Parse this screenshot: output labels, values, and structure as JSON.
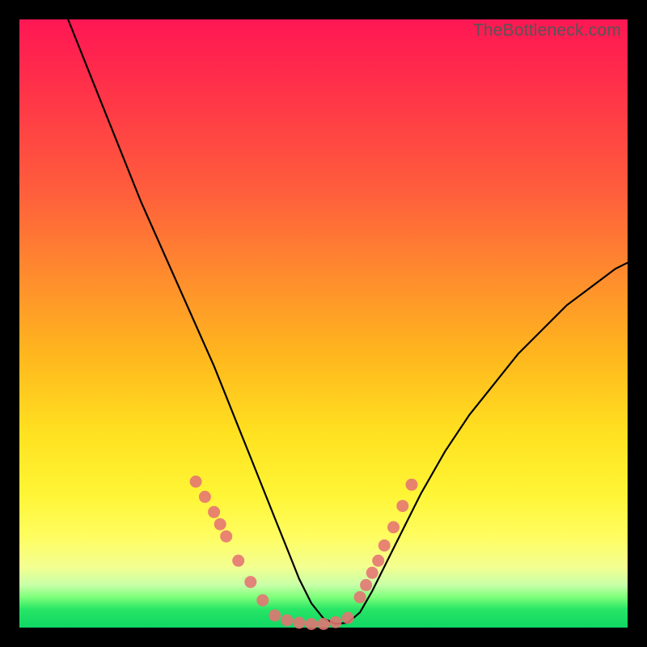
{
  "watermark": "TheBottleneck.com",
  "chart_data": {
    "type": "line",
    "title": "",
    "xlabel": "",
    "ylabel": "",
    "xlim": [
      0,
      100
    ],
    "ylim": [
      0,
      100
    ],
    "grid": false,
    "legend": false,
    "background_gradient": {
      "top": "#ff1754",
      "mid_upper": "#ff8b2e",
      "mid_lower": "#fff535",
      "bottom": "#0fd664"
    },
    "series": [
      {
        "name": "bottleneck-curve",
        "x": [
          8,
          12,
          16,
          20,
          24,
          28,
          32,
          34,
          36,
          38,
          40,
          42,
          44,
          46,
          48,
          50,
          52,
          54,
          56,
          58,
          62,
          66,
          70,
          74,
          78,
          82,
          86,
          90,
          94,
          98,
          100
        ],
        "values": [
          100,
          90,
          80,
          70,
          61,
          52,
          43,
          38,
          33,
          28,
          23,
          18,
          13,
          8,
          4,
          1.5,
          0.6,
          0.8,
          2.5,
          6,
          14,
          22,
          29,
          35,
          40,
          45,
          49,
          53,
          56,
          59,
          60
        ]
      },
      {
        "name": "highlight-dots-left",
        "x": [
          29,
          30.5,
          32,
          33,
          34,
          36,
          38,
          40
        ],
        "values": [
          24,
          21.5,
          19,
          17,
          15,
          11,
          7.5,
          4.5
        ]
      },
      {
        "name": "highlight-dots-bottom",
        "x": [
          42,
          44,
          46,
          48,
          50,
          52,
          54
        ],
        "values": [
          2.0,
          1.2,
          0.8,
          0.6,
          0.6,
          0.9,
          1.6
        ]
      },
      {
        "name": "highlight-dots-right",
        "x": [
          56,
          57,
          58,
          59,
          60,
          61.5,
          63,
          64.5
        ],
        "values": [
          5,
          7,
          9,
          11,
          13.5,
          16.5,
          20,
          23.5
        ]
      }
    ]
  }
}
